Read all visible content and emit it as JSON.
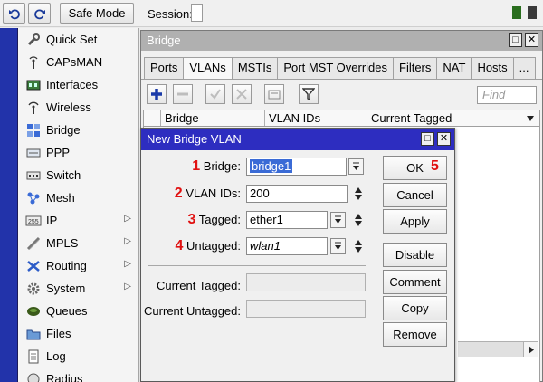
{
  "toolbar": {
    "safe_mode_label": "Safe Mode",
    "session_label": "Session:",
    "status_colors": [
      "#2a6e1e",
      "#3a3a3a"
    ]
  },
  "sidebar": {
    "items": [
      {
        "label": "Quick Set",
        "icon": "wrench-icon",
        "arrow": false
      },
      {
        "label": "CAPsMAN",
        "icon": "antenna-icon",
        "arrow": false
      },
      {
        "label": "Interfaces",
        "icon": "interfaces-icon",
        "arrow": false
      },
      {
        "label": "Wireless",
        "icon": "wireless-icon",
        "arrow": false
      },
      {
        "label": "Bridge",
        "icon": "bridge-icon",
        "arrow": false
      },
      {
        "label": "PPP",
        "icon": "ppp-icon",
        "arrow": false
      },
      {
        "label": "Switch",
        "icon": "switch-icon",
        "arrow": false
      },
      {
        "label": "Mesh",
        "icon": "mesh-icon",
        "arrow": false
      },
      {
        "label": "IP",
        "icon": "ip-icon",
        "arrow": true
      },
      {
        "label": "MPLS",
        "icon": "mpls-icon",
        "arrow": true
      },
      {
        "label": "Routing",
        "icon": "routing-icon",
        "arrow": true
      },
      {
        "label": "System",
        "icon": "gear-icon",
        "arrow": true
      },
      {
        "label": "Queues",
        "icon": "queues-icon",
        "arrow": false
      },
      {
        "label": "Files",
        "icon": "folder-icon",
        "arrow": false
      },
      {
        "label": "Log",
        "icon": "log-icon",
        "arrow": false
      },
      {
        "label": "Radius",
        "icon": "radius-icon",
        "arrow": false
      }
    ]
  },
  "bridge_window": {
    "title": "Bridge",
    "tabs": [
      "Ports",
      "VLANs",
      "MSTIs",
      "Port MST Overrides",
      "Filters",
      "NAT",
      "Hosts",
      "..."
    ],
    "active_tab": "VLANs",
    "find_placeholder": "Find",
    "columns": [
      "Bridge",
      "VLAN IDs",
      "Current Tagged"
    ]
  },
  "dialog": {
    "title": "New Bridge VLAN",
    "fields": {
      "bridge": {
        "num": "1",
        "label": "Bridge:",
        "value": "bridge1"
      },
      "vlan_ids": {
        "num": "2",
        "label": "VLAN IDs:",
        "value": "200"
      },
      "tagged": {
        "num": "3",
        "label": "Tagged:",
        "value": "ether1"
      },
      "untagged": {
        "num": "4",
        "label": "Untagged:",
        "value": "wlan1"
      },
      "current_tagged": {
        "label": "Current Tagged:",
        "value": ""
      },
      "current_untagged": {
        "label": "Current Untagged:",
        "value": ""
      }
    },
    "buttons": {
      "ok": "OK",
      "ok_num": "5",
      "cancel": "Cancel",
      "apply": "Apply",
      "disable": "Disable",
      "comment": "Comment",
      "copy": "Copy",
      "remove": "Remove"
    },
    "annotation_color": "#e01010"
  }
}
